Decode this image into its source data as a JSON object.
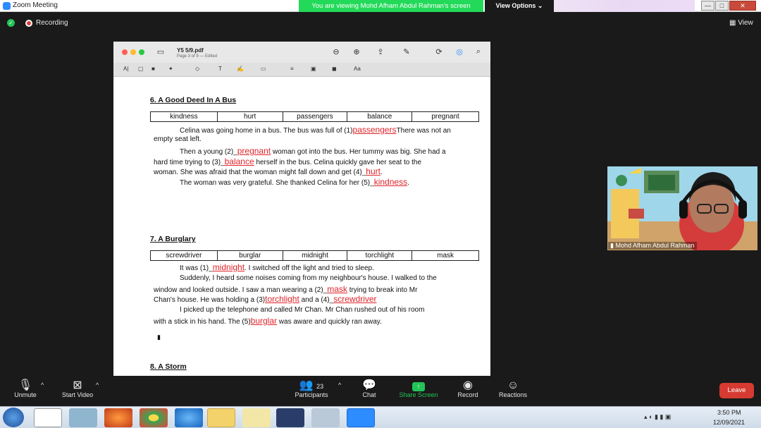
{
  "window": {
    "title": "Zoom Meeting",
    "viewing_banner": "You are viewing Mohd Afham Abdul Rahman's screen",
    "view_options": "View Options",
    "min": "—",
    "max": "□",
    "close": "✕"
  },
  "status": {
    "recording": "Recording",
    "view": "View"
  },
  "pdf": {
    "file_name": "Y5 5/9.pdf",
    "file_sub": "Page 3 of 9 — Edited"
  },
  "doc": {
    "sec6": {
      "heading": "6. A Good Deed In A Bus",
      "words": [
        "kindness",
        "hurt",
        "passengers",
        "balance",
        "pregnant"
      ],
      "l1a": "Celina was going home in a bus. The bus was full of (1)",
      "a1": "passengers",
      "l1b": "There was not an",
      "l2": "empty seat left.",
      "l3a": "Then a young (2)_",
      "a2": "pregnant",
      "l3b": "woman got into the bus. Her tummy was big. She had a",
      "l4a": "hard time trying to (3)_",
      "a3": "balance",
      "l4b": "herself in the bus. Celina quickly gave her seat to the",
      "l5a": "woman. She was afraid that the woman might fall down and get (4)_",
      "a4": "hurt",
      "l6a": "The woman was very grateful. She thanked Celina for her (5)_",
      "a5": "kindness"
    },
    "sec7": {
      "heading": "7. A Burglary",
      "words": [
        "screwdriver",
        "burglar",
        "midnight",
        "torchlight",
        "mask"
      ],
      "l1a": "It was (1)_",
      "a1": "midnight",
      "l1b": ". I switched off the light and tried to sleep.",
      "l2": "Suddenly, I heard some noises coming from my neighbour's house. I walked to the",
      "l3a": "window and looked outside. I saw a man wearing a (2)_",
      "a2": "mask",
      "l3b": "trying to break into Mr",
      "l4a": "Chan's house. He was holding a (3)",
      "a3": "torchlight",
      "l4b": "and a (4)_",
      "a4": "screwdriver",
      "l5": "I picked up the telephone and called Mr Chan. Mr Chan rushed out of his room",
      "l6a": "with a stick in his hand. The (5)",
      "a5": "burglar",
      "l6b": "was aware and quickly ran away."
    },
    "sec8": {
      "heading": "8. A Storm"
    }
  },
  "video": {
    "participant_name": "Mohd Afham Abdul Rahman"
  },
  "toolbar": {
    "unmute": "Unmute",
    "start_video": "Start Video",
    "participants": "Participants",
    "participants_count": "23",
    "chat": "Chat",
    "share_screen": "Share Screen",
    "record": "Record",
    "reactions": "Reactions",
    "leave": "Leave"
  },
  "taskbar": {
    "time": "3:50 PM",
    "date": "12/09/2021"
  },
  "colors": {
    "banner_green": "#23d959",
    "answer_red": "#e0242a",
    "leave_red": "#d63a31",
    "share_green": "#23c457"
  }
}
